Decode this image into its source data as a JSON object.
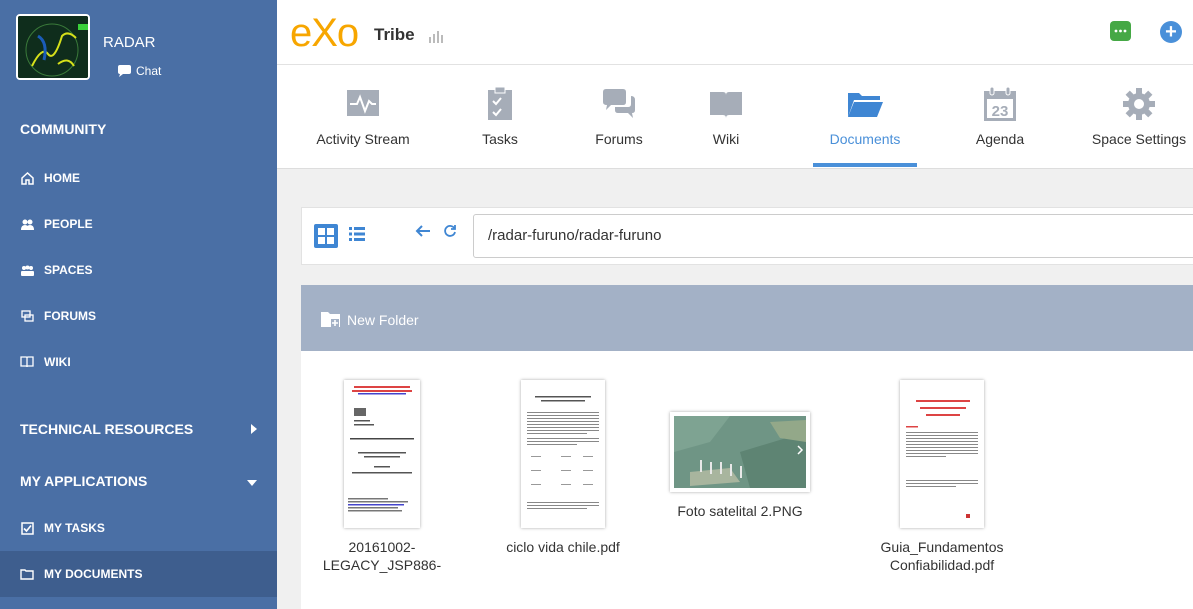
{
  "user": {
    "name": "RADAR",
    "chat_label": "Chat"
  },
  "topbar": {
    "brand": "eXo",
    "space_name": "Tribe"
  },
  "sidebar": {
    "community_title": "COMMUNITY",
    "items": [
      {
        "label": "HOME",
        "icon": "home-icon"
      },
      {
        "label": "PEOPLE",
        "icon": "people-icon"
      },
      {
        "label": "SPACES",
        "icon": "spaces-icon"
      },
      {
        "label": "FORUMS",
        "icon": "forums-icon"
      },
      {
        "label": "WIKI",
        "icon": "wiki-icon"
      }
    ],
    "technical_title": "TECHNICAL RESOURCES",
    "apps_title": "MY APPLICATIONS",
    "app_items": [
      {
        "label": "MY TASKS",
        "icon": "checkbox-icon"
      },
      {
        "label": "MY DOCUMENTS",
        "icon": "folder-icon",
        "active": true
      }
    ]
  },
  "nav": {
    "tabs": [
      {
        "label": "Activity Stream",
        "icon": "activity-icon"
      },
      {
        "label": "Tasks",
        "icon": "tasks-icon"
      },
      {
        "label": "Forums",
        "icon": "forums-icon"
      },
      {
        "label": "Wiki",
        "icon": "wiki-icon"
      },
      {
        "label": "Documents",
        "icon": "documents-icon",
        "active": true
      },
      {
        "label": "Agenda",
        "icon": "calendar-icon",
        "day": "23"
      },
      {
        "label": "Space Settings",
        "icon": "gear-icon"
      }
    ]
  },
  "documents": {
    "path": "/radar-furuno/radar-furuno",
    "new_folder_label": "New Folder",
    "files": [
      {
        "name": "20161002-LEGACY_JSP886-",
        "type": "pdf"
      },
      {
        "name": "ciclo vida chile.pdf",
        "type": "pdf"
      },
      {
        "name": "Foto satelital 2.PNG",
        "type": "png"
      },
      {
        "name": "Guia_Fundamentos Confiabilidad.pdf",
        "type": "pdf"
      }
    ]
  },
  "colors": {
    "sidebar_bg": "#4a6fa5",
    "accent": "#4a90d9",
    "brand": "#f7a600",
    "action_bar": "#a3b1c6"
  }
}
